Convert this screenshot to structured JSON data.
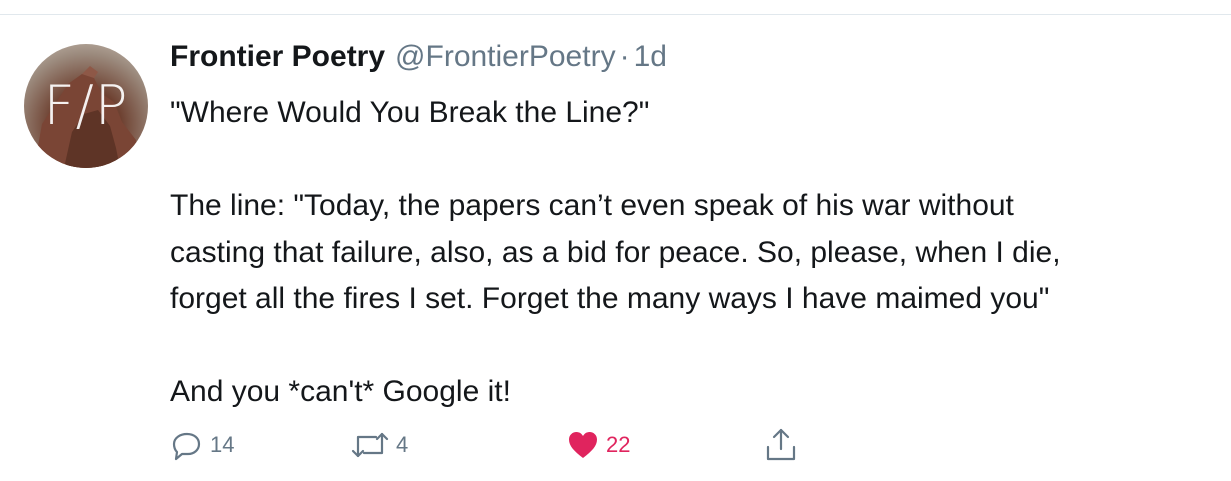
{
  "tweet": {
    "author": {
      "display_name": "Frontier Poetry",
      "handle": "@FrontierPoetry",
      "avatar_text": "F/P"
    },
    "separator": "·",
    "timestamp": "1d",
    "lines": [
      "\"Where Would You Break the Line?\"",
      "",
      "The line: \"Today, the papers can’t even speak of his war without",
      "casting that failure, also, as a bid for peace. So, please, when I die,",
      "forget all the fires I set. Forget the many ways I have maimed you\"",
      "",
      "And you *can't* Google it!"
    ],
    "actions": {
      "reply": {
        "icon": "reply-icon",
        "count": "14"
      },
      "retweet": {
        "icon": "retweet-icon",
        "count": "4"
      },
      "like": {
        "icon": "heart-icon",
        "count": "22",
        "liked": true,
        "color": "#e0245e"
      },
      "share": {
        "icon": "share-icon"
      }
    }
  },
  "colors": {
    "text": "#14171a",
    "secondary": "#657786",
    "divider": "#e1e8ed",
    "like": "#e0245e"
  }
}
